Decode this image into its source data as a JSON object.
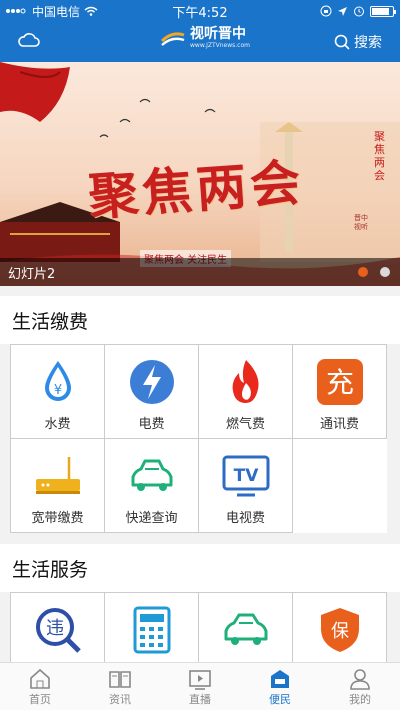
{
  "status_bar": {
    "carrier": "中国电信",
    "time": "下午4:52"
  },
  "header": {
    "logo_title": "视听晋中",
    "logo_subtitle": "www.JZTVnews.com",
    "search_label": "搜索"
  },
  "banner": {
    "headline": "聚焦两会",
    "subtitle": "聚焦两会 关注民生",
    "side_text": "聚焦两会",
    "side_text2": "晋中视听",
    "caption": "幻灯片2",
    "slide_count": 2,
    "active_slide": 1
  },
  "sections": [
    {
      "title": "生活缴费",
      "items": [
        {
          "label": "水费",
          "icon": "water-drop-icon"
        },
        {
          "label": "电费",
          "icon": "lightning-icon"
        },
        {
          "label": "燃气费",
          "icon": "flame-icon"
        },
        {
          "label": "通讯费",
          "icon": "recharge-icon",
          "icon_text": "充"
        },
        {
          "label": "宽带缴费",
          "icon": "router-icon"
        },
        {
          "label": "快递查询",
          "icon": "delivery-car-icon"
        },
        {
          "label": "电视费",
          "icon": "tv-icon",
          "icon_text": "TV"
        }
      ]
    },
    {
      "title": "生活服务",
      "items": [
        {
          "icon": "violation-search-icon",
          "icon_text": "违"
        },
        {
          "icon": "calculator-icon"
        },
        {
          "icon": "car-icon"
        },
        {
          "icon": "insurance-shield-icon",
          "icon_text": "保"
        }
      ]
    }
  ],
  "tab_bar": {
    "tabs": [
      {
        "label": "首页",
        "icon": "home-icon"
      },
      {
        "label": "资讯",
        "icon": "news-icon"
      },
      {
        "label": "直播",
        "icon": "live-play-icon"
      },
      {
        "label": "便民",
        "icon": "service-icon"
      },
      {
        "label": "我的",
        "icon": "user-icon"
      }
    ],
    "active_index": 3
  },
  "colors": {
    "primary": "#1a74c9",
    "accent_orange": "#e8601c",
    "grid_border": "#cccccc"
  }
}
